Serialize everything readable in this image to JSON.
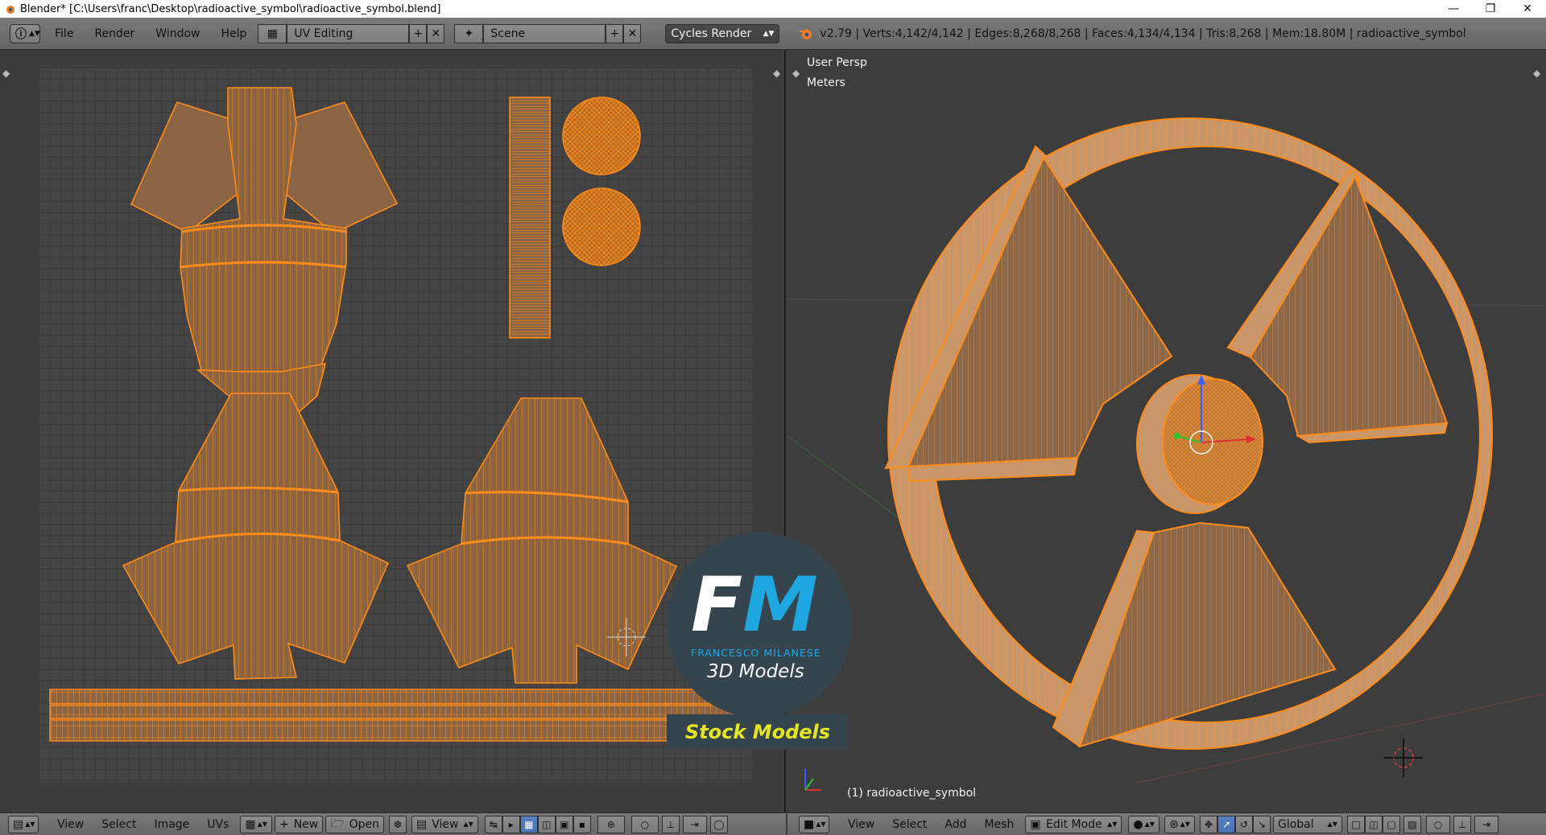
{
  "window": {
    "title": "Blender* [C:\\Users\\franc\\Desktop\\radioactive_symbol\\radioactive_symbol.blend]",
    "controls": [
      "minimize",
      "restore",
      "close"
    ]
  },
  "info_header": {
    "menus": [
      "File",
      "Render",
      "Window",
      "Help"
    ],
    "screen_layout": "UV Editing",
    "scene": "Scene",
    "render_engine": "Cycles Render",
    "stats": "v2.79 | Verts:4,142/4,142 | Edges:8,268/8,268 | Faces:4,134/4,134 | Tris:8,268 | Mem:18.80M | radioactive_symbol"
  },
  "viewport": {
    "view_name": "User Persp",
    "units": "Meters",
    "object_label": "(1) radioactive_symbol"
  },
  "uv_header": {
    "menus": [
      "View",
      "Select",
      "Image",
      "UVs"
    ],
    "new_label": "New",
    "open_label": "Open",
    "view_label": "View"
  },
  "view3d_header": {
    "menus": [
      "View",
      "Select",
      "Add",
      "Mesh"
    ],
    "mode": "Edit Mode",
    "orientation": "Global"
  },
  "watermark": {
    "logo_f": "F",
    "logo_m": "M",
    "name": "FRANCESCO MILANESE",
    "tagline": "3D Models",
    "banner": "Stock Models"
  },
  "colors": {
    "accent_orange": "#ff8c1a",
    "mesh_fill": "#8a6443",
    "header_gray": "#727272",
    "selected_blue": "#5680c2"
  }
}
